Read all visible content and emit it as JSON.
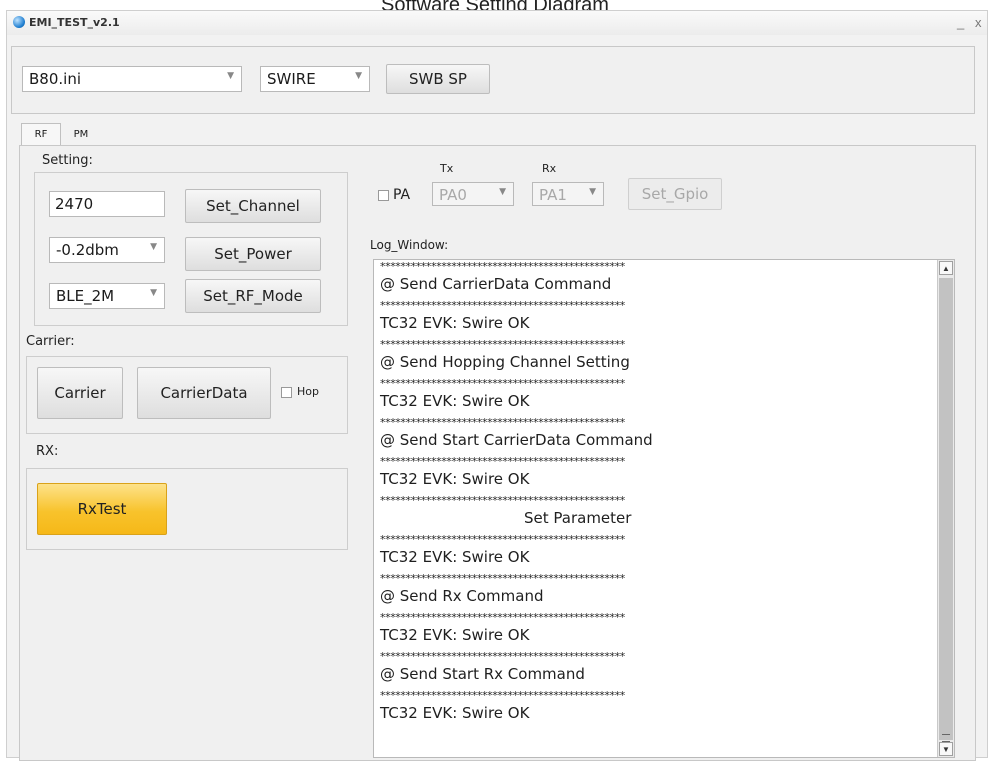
{
  "caption": "Software Setting Diagram",
  "window": {
    "title": "EMI_TEST_v2.1",
    "minimize_glyph": "_",
    "close_glyph": "x"
  },
  "top": {
    "config_select": "B80.ini",
    "mode_select": "SWIRE",
    "swb_sp_label": "SWB SP"
  },
  "tabs": [
    {
      "label": "RF",
      "active": true
    },
    {
      "label": "PM",
      "active": false
    }
  ],
  "setting": {
    "heading": "Setting:",
    "channel_value": "2470",
    "set_channel_label": "Set_Channel",
    "power_value": "-0.2dbm",
    "set_power_label": "Set_Power",
    "rf_mode_value": "BLE_2M",
    "set_rf_mode_label": "Set_RF_Mode"
  },
  "carrier": {
    "heading": "Carrier:",
    "carrier_label": "Carrier",
    "carrierdata_label": "CarrierData",
    "hop_label": "Hop",
    "hop_checked": false
  },
  "rx": {
    "heading": "RX:",
    "rxtest_label": "RxTest",
    "accent": "#f8c32c"
  },
  "gpio": {
    "pa_label": "PA",
    "pa_checked": false,
    "tx_label": "Tx",
    "rx_label": "Rx",
    "tx_value": "PA0",
    "rx_value": "PA1",
    "set_gpio_label": "Set_Gpio"
  },
  "log": {
    "heading": "Log_Window:",
    "lines": [
      "************************************************",
      "@ Send CarrierData Command",
      "************************************************",
      "TC32 EVK: Swire OK",
      "************************************************",
      "@ Send Hopping Channel Setting",
      "************************************************",
      "TC32 EVK: Swire OK",
      "************************************************",
      "@ Send Start CarrierData Command",
      "************************************************",
      "TC32 EVK: Swire OK",
      "************************************************",
      "Set Parameter",
      "************************************************",
      "TC32 EVK: Swire OK",
      "************************************************",
      "@ Send Rx Command",
      "************************************************",
      "TC32 EVK: Swire OK",
      "************************************************",
      "@ Send Start Rx Command",
      "************************************************",
      "TC32 EVK: Swire OK"
    ]
  },
  "icons": {
    "app": "app-logo-icon",
    "scroll_up": "scroll-up-icon",
    "scroll_down": "scroll-down-icon"
  }
}
